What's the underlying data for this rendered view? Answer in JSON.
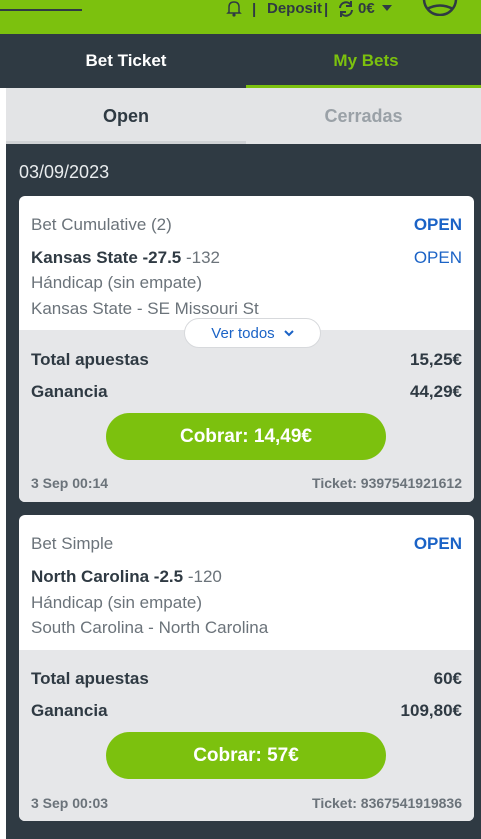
{
  "topbar": {
    "deposit_label": "Deposit",
    "separator": "|",
    "balance": "0€",
    "icons": [
      "bell-icon",
      "refresh-icon",
      "user-icon",
      "caret-down-icon"
    ]
  },
  "tabs": {
    "bet_ticket": "Bet Ticket",
    "my_bets": "My Bets"
  },
  "subtabs": {
    "open": "Open",
    "closed": "Cerradas"
  },
  "date": "03/09/2023",
  "colors": {
    "accent": "#7cc10e",
    "dark": "#2f3a43",
    "link": "#1b63c6"
  },
  "bets": [
    {
      "type": "Bet Cumulative (2)",
      "status": "OPEN",
      "selection": "Kansas State -27.5",
      "odds": "-132",
      "selection_status": "OPEN",
      "market": "Hándicap (sin empate)",
      "event": "Kansas State - SE Missouri St",
      "ver_todos": "Ver todos",
      "total_label": "Total apuestas",
      "total_value": "15,25€",
      "gain_label": "Ganancia",
      "gain_value": "44,29€",
      "cashout": "Cobrar: 14,49€",
      "time": "3 Sep 00:14",
      "ticket": "Ticket: 9397541921612"
    },
    {
      "type": "Bet Simple",
      "status": "OPEN",
      "selection": "North Carolina -2.5",
      "odds": "-120",
      "market": "Hándicap (sin empate)",
      "event": "South Carolina - North Carolina",
      "total_label": "Total apuestas",
      "total_value": "60€",
      "gain_label": "Ganancia",
      "gain_value": "109,80€",
      "cashout": "Cobrar: 57€",
      "time": "3 Sep 00:03",
      "ticket": "Ticket: 8367541919836"
    }
  ]
}
